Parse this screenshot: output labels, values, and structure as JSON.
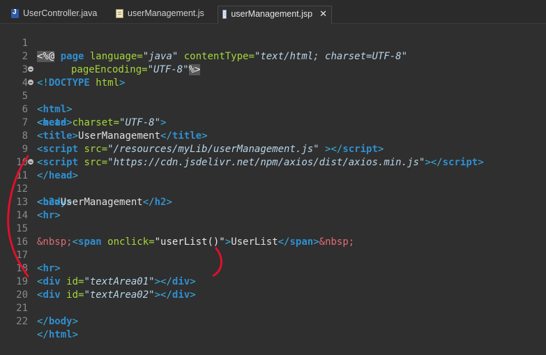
{
  "tabs": [
    {
      "label": "UserController.java",
      "icon": "java-file-icon"
    },
    {
      "label": "userManagement.js",
      "icon": "js-file-icon"
    },
    {
      "label": "userManagement.jsp",
      "icon": "jsp-file-icon",
      "active": true,
      "close": "✕"
    }
  ],
  "code": {
    "l1": {
      "n": "1",
      "a": "<%@",
      "b": " page ",
      "c": "language=",
      "d": "\"java\"",
      "e": " contentType=",
      "f": "\"text/html; charset=UTF-8\""
    },
    "l2": {
      "n": "2",
      "a": "pageEncoding=",
      "b": "\"UTF-8\"",
      "c": "%>"
    },
    "l3": {
      "n": "3",
      "a": "<!",
      "b": "DOCTYPE",
      "c": " html",
      "d": ">"
    },
    "l4": {
      "n": "4",
      "a": "<",
      "b": "html",
      "c": ">"
    },
    "l5": {
      "n": "5",
      "a": "<",
      "b": "head",
      "c": ">"
    },
    "l6": {
      "n": "6",
      "a": "<",
      "b": "meta",
      "c": " charset=",
      "d": "\"UTF-8\"",
      "e": ">"
    },
    "l7": {
      "n": "7",
      "a": "<",
      "b": "title",
      "c": ">",
      "d": "UserManagement",
      "e": "</",
      "f": "title",
      "g": ">"
    },
    "l8": {
      "n": "8",
      "a": "<",
      "b": "script",
      "c": " src=",
      "d": "\"/resources/myLib/userManagement.js\"",
      "e": " ></",
      "f": "script",
      "g": ">"
    },
    "l9": {
      "n": "9",
      "a": "<",
      "b": "script",
      "c": " src=",
      "d": "\"https://cdn.jsdelivr.net/npm/axios/dist/axios.min.js\"",
      "e": "></",
      "f": "script",
      "g": ">"
    },
    "l10": {
      "n": "10",
      "a": "</",
      "b": "head",
      "c": ">"
    },
    "l11": {
      "n": "11",
      "a": "<",
      "b": "body",
      "c": ">"
    },
    "l12": {
      "n": "12",
      "a": "<",
      "b": "h2",
      "c": ">",
      "d": "UserManagement",
      "e": "</",
      "f": "h2",
      "g": ">"
    },
    "l13": {
      "n": "13",
      "a": "<",
      "b": "hr",
      "c": ">"
    },
    "l14": {
      "n": "14"
    },
    "l15": {
      "n": "15",
      "a": "&nbsp;",
      "b": "<",
      "c": "span",
      "d": " onclick=",
      "e": "\"userList()\"",
      "f": ">",
      "g": "UserList",
      "h": "</",
      "i": "span",
      "j": ">",
      "k": "&nbsp;"
    },
    "l16": {
      "n": "16"
    },
    "l17": {
      "n": "17",
      "a": "<",
      "b": "hr",
      "c": ">"
    },
    "l18": {
      "n": "18",
      "a": "<",
      "b": "div",
      "c": " id=",
      "d": "\"textArea01\"",
      "e": "></",
      "f": "div",
      "g": ">"
    },
    "l19": {
      "n": "19",
      "a": "<",
      "b": "div",
      "c": " id=",
      "d": "\"textArea02\"",
      "e": "></",
      "f": "div",
      "g": ">"
    },
    "l20": {
      "n": "20"
    },
    "l21": {
      "n": "21",
      "a": "</",
      "b": "body",
      "c": ">"
    },
    "l22": {
      "n": "22",
      "a": "</",
      "b": "html",
      "c": ">"
    }
  },
  "colors": {
    "background": "#2f2f2f",
    "tag": "#3bb0e0",
    "tag_name": "#2f8fd0",
    "attribute": "#a6d63a",
    "annotation": "#e0102a"
  }
}
